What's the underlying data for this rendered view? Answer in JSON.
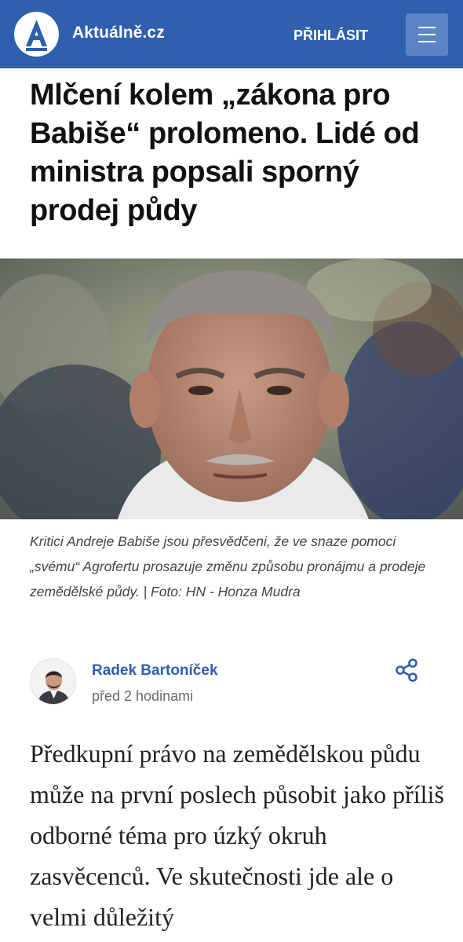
{
  "header": {
    "brand": "Aktuálně.cz",
    "login_label": "PŘIHLÁSIT",
    "logo_icon": "aktualne-logo-icon",
    "menu_icon": "hamburger-menu-icon",
    "colors": {
      "bar": "#2f5fae",
      "menu_button": "#5b84c5"
    }
  },
  "article": {
    "headline": "Mlčení kolem „zákona pro Babiše“ prolomeno. Lidé od ministra popsali sporný prodej půdy",
    "photo_icon": "article-photo",
    "caption": "Kritici Andreje Babiše jsou přesvědčeni, že ve snaze pomoci „svému“ Agrofertu prosazuje změnu způsobu pronájmu a prodeje zemědělské půdy.  | Foto: HN - Honza Mudra",
    "author": {
      "name": "Radek Bartoníček",
      "published": "před 2 hodinami",
      "avatar_icon": "author-avatar"
    },
    "share_icon": "share-icon",
    "lead_text": "Předkupní právo na zemědělskou půdu může na první poslech působit jako příliš odborné téma pro úzký okruh zasvěcenců. Ve skutečnosti jde ale o velmi důležitý"
  }
}
